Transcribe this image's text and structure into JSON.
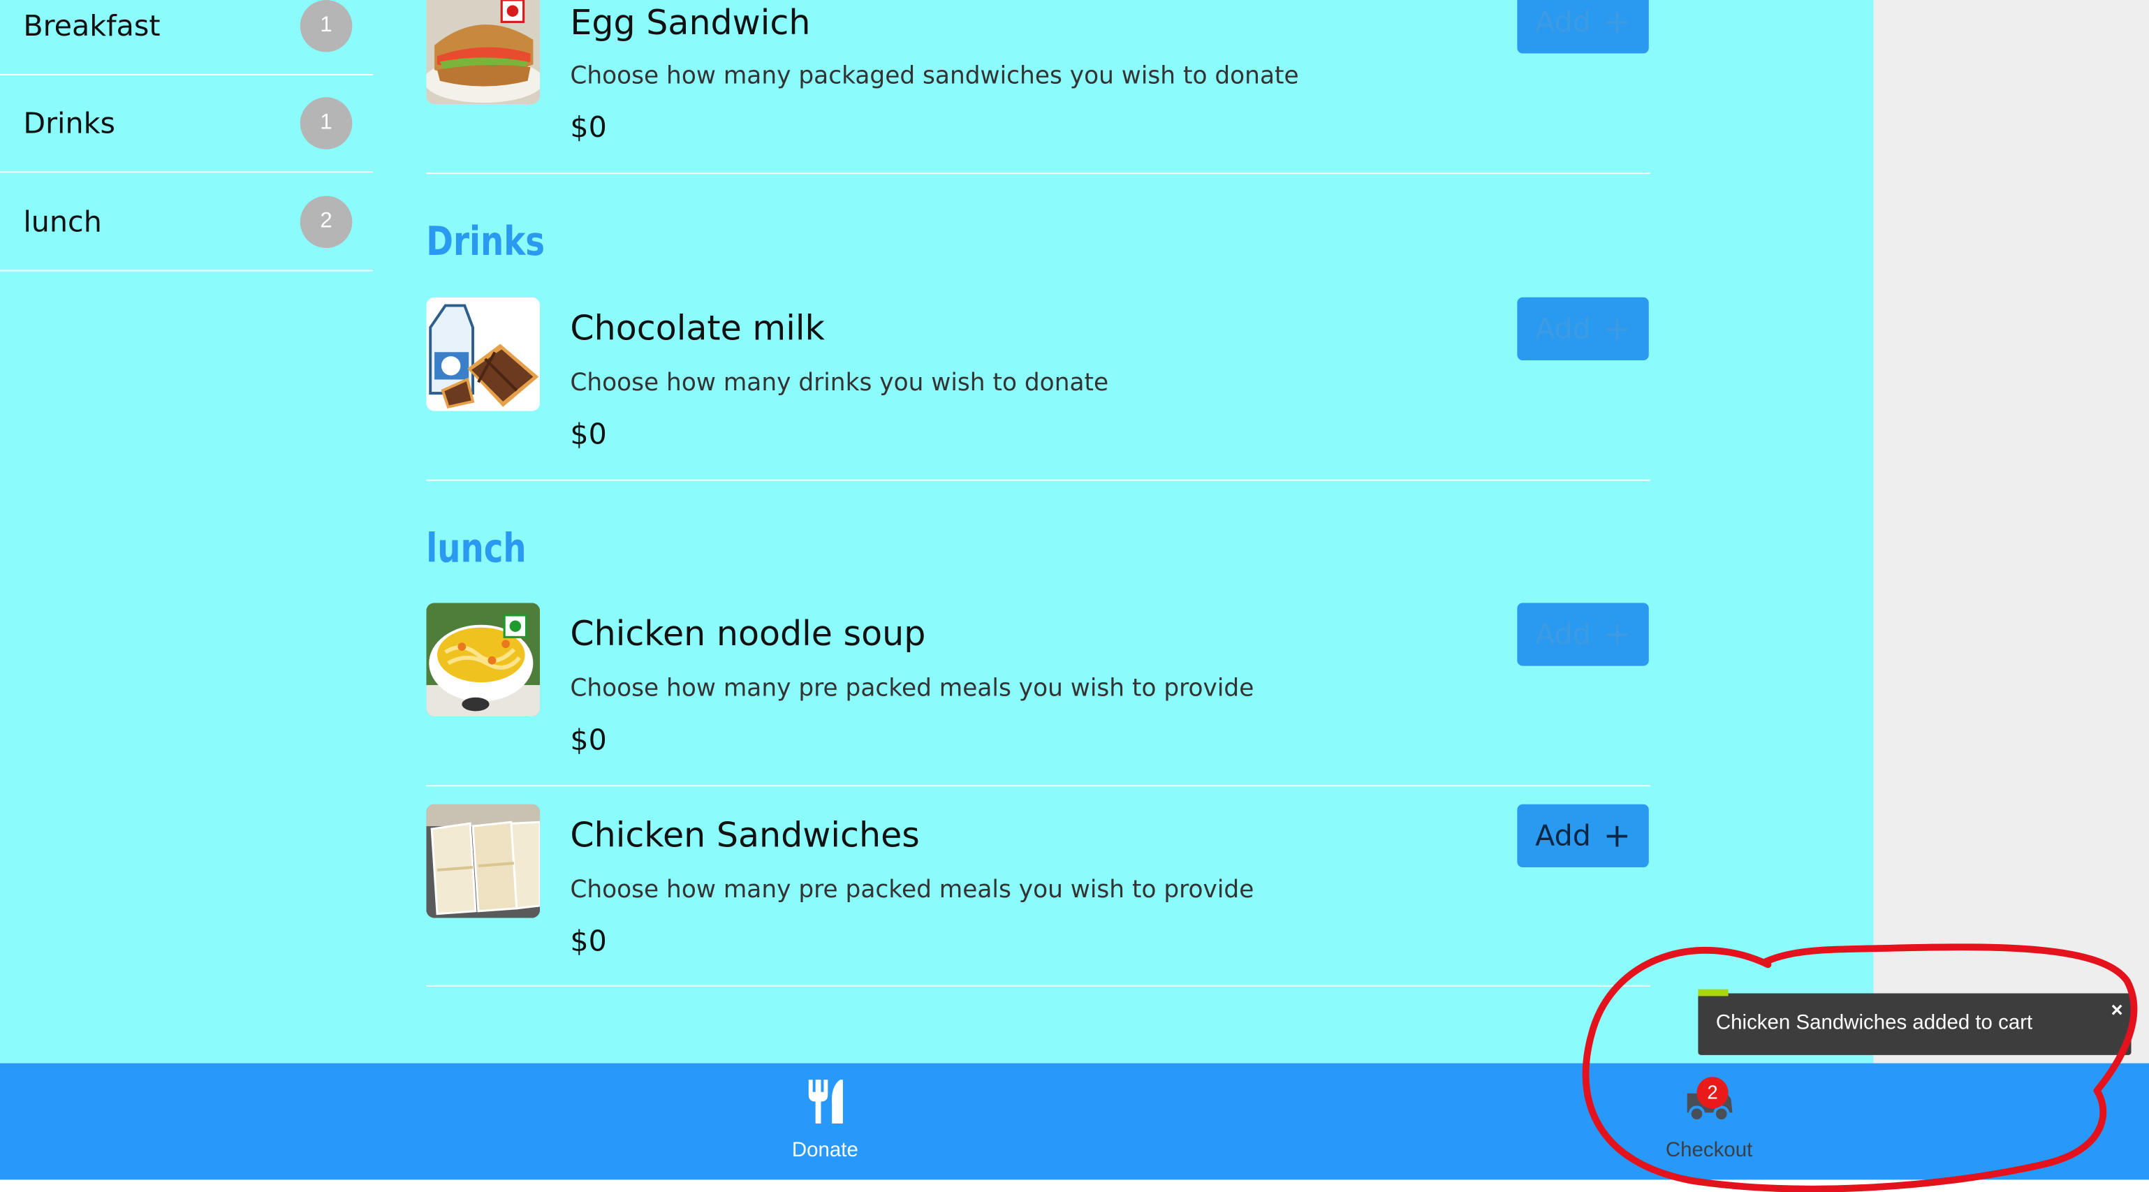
{
  "sidebar": {
    "items": [
      {
        "label": "Breakfast",
        "count": "1"
      },
      {
        "label": "Drinks",
        "count": "1"
      },
      {
        "label": "lunch",
        "count": "2"
      }
    ]
  },
  "sections": {
    "drinks_heading": "Drinks",
    "lunch_heading": "lunch"
  },
  "items": {
    "egg_sandwich": {
      "title": "Egg Sandwich",
      "description": "Choose how many packaged sandwiches you wish to donate",
      "price": "$0",
      "add_label": "Add",
      "add_icon": "plus-icon"
    },
    "chocolate_milk": {
      "title": "Chocolate milk",
      "description": "Choose how many drinks you wish to donate",
      "price": "$0",
      "add_label": "Add",
      "add_icon": "plus-icon"
    },
    "chicken_noodle_soup": {
      "title": "Chicken noodle soup",
      "description": "Choose how many pre packed meals you wish to provide",
      "price": "$0",
      "add_label": "Add",
      "add_icon": "plus-icon"
    },
    "chicken_sandwiches": {
      "title": "Chicken Sandwiches",
      "description": "Choose how many pre packed meals you wish to provide",
      "price": "$0",
      "add_label": "Add",
      "add_icon": "plus-icon"
    }
  },
  "bottom_nav": {
    "donate": {
      "label": "Donate",
      "icon": "fork-knife-icon"
    },
    "checkout": {
      "label": "Checkout",
      "icon": "delivery-truck-icon",
      "badge": "2"
    }
  },
  "toast": {
    "message": "Chicken Sandwiches added to cart",
    "close_label": "×"
  },
  "colors": {
    "page_background": "#8cfbfb",
    "accent_blue": "#2a9af0",
    "nav_blue": "#2898f9",
    "badge_red": "#e91a1a",
    "toast_background": "#3d3d3d",
    "annotation_red": "#e3121c",
    "veg_mark_green": "#1f9a2d",
    "nonveg_mark_red": "#d81b1b"
  }
}
